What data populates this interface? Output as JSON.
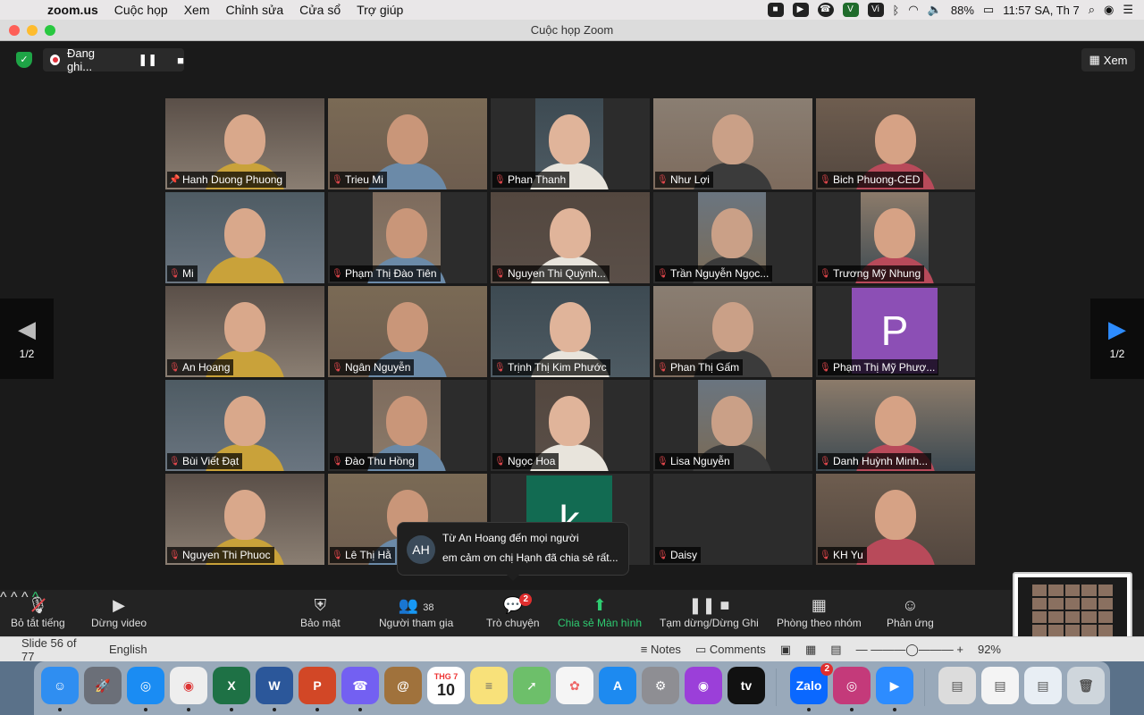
{
  "menubar": {
    "app_name": "zoom.us",
    "items": [
      "Cuộc họp",
      "Xem",
      "Chỉnh sửa",
      "Cửa sổ",
      "Trợ giúp"
    ],
    "battery": "88%",
    "clock": "11:57 SA, Th 7"
  },
  "window": {
    "title": "Cuộc họp Zoom"
  },
  "recording": {
    "label": "Đang ghi..."
  },
  "view_button": {
    "label": "Xem"
  },
  "pager": {
    "left": "1/2",
    "right": "1/2"
  },
  "participants": [
    {
      "name": "Hanh Duong Phuong",
      "icon": "pin-icon",
      "active": true
    },
    {
      "name": "Trieu Mi",
      "icon": "muted-mic-icon"
    },
    {
      "name": "Phan Thanh",
      "icon": "muted-mic-icon"
    },
    {
      "name": "Như Lợi",
      "icon": "muted-mic-icon"
    },
    {
      "name": "Bich Phuong-CED",
      "icon": "muted-mic-icon"
    },
    {
      "name": "Mi",
      "icon": "muted-mic-icon"
    },
    {
      "name": "Phạm Thị Đào Tiên",
      "icon": "muted-mic-icon"
    },
    {
      "name": "Nguyen Thi Quỳnh...",
      "icon": "muted-mic-icon"
    },
    {
      "name": "Trần Nguyễn Ngọc...",
      "icon": "muted-mic-icon"
    },
    {
      "name": "Trương Mỹ Nhung",
      "icon": "muted-mic-icon"
    },
    {
      "name": "An Hoang",
      "icon": "muted-mic-icon"
    },
    {
      "name": "Ngân Nguyễn",
      "icon": "muted-mic-icon"
    },
    {
      "name": "Trịnh Thị Kim Phước",
      "icon": "muted-mic-icon"
    },
    {
      "name": "Phan Thị Gấm",
      "icon": "muted-mic-icon"
    },
    {
      "name": "Phạm Thị Mỹ Phượ...",
      "icon": "muted-mic-icon",
      "avatar": "P"
    },
    {
      "name": "Bùi Viết Đạt",
      "icon": "muted-mic-icon"
    },
    {
      "name": "Đào Thu Hồng",
      "icon": "muted-mic-icon"
    },
    {
      "name": "Ngọc Hoa",
      "icon": "muted-mic-icon"
    },
    {
      "name": "Lisa Nguyễn",
      "icon": "muted-mic-icon"
    },
    {
      "name": "Danh Huỳnh Minh...",
      "icon": "muted-mic-icon"
    },
    {
      "name": "Nguyen Thi Phuoc",
      "icon": "muted-mic-icon"
    },
    {
      "name": "Lê Thị Hằ",
      "icon": "muted-mic-icon"
    },
    {
      "name": "",
      "icon": "",
      "avatar": "k"
    },
    {
      "name": "Daisy",
      "icon": "muted-mic-icon"
    },
    {
      "name": "KH Yu",
      "icon": "muted-mic-icon"
    }
  ],
  "chat_popup": {
    "avatar": "AH",
    "from": "Từ An Hoang đến mọi người",
    "message": "em cảm ơn chị Hạnh đã chia sẻ rất..."
  },
  "toolbar": {
    "mute": "Bỏ tắt tiếng",
    "video": "Dừng video",
    "security": "Bảo mật",
    "participants": "Người tham gia",
    "participants_count": "38",
    "chat": "Trò chuyện",
    "chat_badge": "2",
    "share": "Chia sẻ Màn hình",
    "record": "Tạm dừng/Dừng Ghi",
    "breakout": "Phòng theo nhóm",
    "reactions": "Phản ứng"
  },
  "statusbar": {
    "slide": "Slide 56 of 77",
    "language": "English",
    "notes": "Notes",
    "comments": "Comments",
    "zoom": "92%"
  },
  "dock": {
    "calendar_month": "THG 7",
    "calendar_day": "10",
    "zalo_badge": "2"
  }
}
